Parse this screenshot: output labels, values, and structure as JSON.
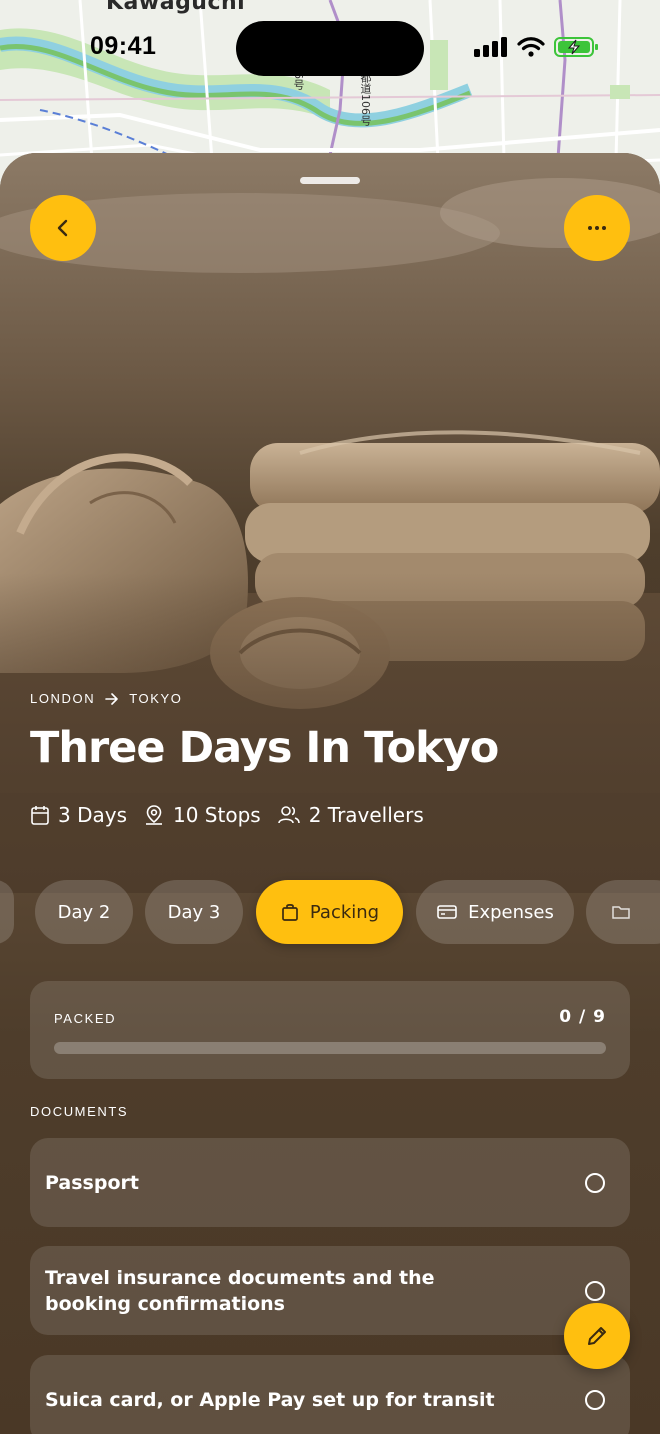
{
  "status_bar": {
    "time": "09:41",
    "icons": [
      "cellular-signal-icon",
      "wifi-icon",
      "battery-charging-icon"
    ]
  },
  "map": {
    "place_label": "Kawaguchi",
    "road_label_1": "6号",
    "road_label_2": "都道106号"
  },
  "header": {
    "back_icon": "chevron-left-icon",
    "more_icon": "ellipsis-icon"
  },
  "trip": {
    "origin": "LONDON",
    "destination": "TOKYO",
    "title": "Three Days In Tokyo",
    "days": "3 Days",
    "stops": "10 Stops",
    "travellers": "2 Travellers"
  },
  "tabs": [
    {
      "label": "Day 2",
      "active": false
    },
    {
      "label": "Day 3",
      "active": false
    },
    {
      "label": "Packing",
      "active": true,
      "icon": "bag-icon"
    },
    {
      "label": "Expenses",
      "active": false,
      "icon": "card-icon"
    },
    {
      "label": "",
      "active": false,
      "icon": "folder-icon"
    }
  ],
  "packed": {
    "label": "PACKED",
    "count": "0 / 9",
    "progress": 0
  },
  "documents": {
    "heading": "DOCUMENTS",
    "items": [
      {
        "label": "Passport",
        "checked": false
      },
      {
        "label": "Travel insurance documents and the booking confirmations",
        "checked": false
      },
      {
        "label": "Suica card, or Apple Pay set up for transit",
        "checked": false
      }
    ]
  },
  "fab_icon": "pencil-icon",
  "colors": {
    "accent": "#ffbf0f",
    "sheet": "#4e3d2b"
  }
}
